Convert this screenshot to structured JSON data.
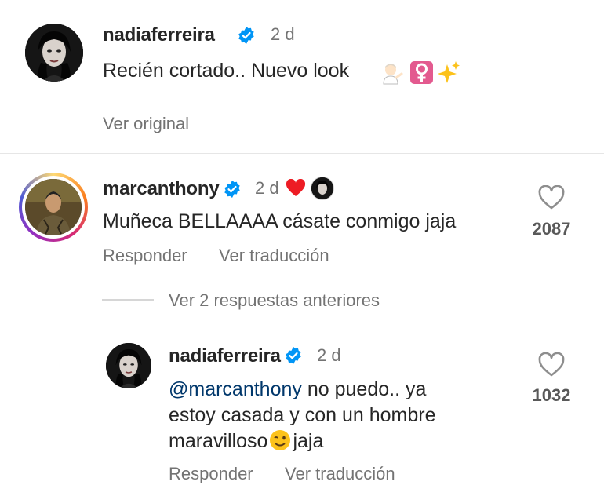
{
  "caption": {
    "username": "nadiaferreira",
    "time": "2 d",
    "text": "Recién cortado.. Nuevo look",
    "see_original": "Ver original"
  },
  "comments": [
    {
      "username": "marcanthony",
      "time": "2 d",
      "text": "Muñeca BELLAAAA cásate conmigo jaja",
      "likes": "2087",
      "reply_label": "Responder",
      "translate_label": "Ver traducción",
      "has_story_ring": true
    }
  ],
  "view_replies": "Ver 2 respuestas anteriores",
  "reply": {
    "username": "nadiaferreira",
    "time": "2 d",
    "mention": "@marcanthony",
    "line1": " no puedo.. ya",
    "line2": "estoy casada y con un hombre",
    "line3": "maravilloso",
    "line3_after": "jaja",
    "likes": "1032",
    "reply_label": "Responder",
    "translate_label": "Ver traducción"
  },
  "colors": {
    "verified_blue": "#0095f6",
    "heart_red": "#ed4956",
    "text_dark": "#262626",
    "text_gray": "#737373",
    "mention_blue": "#00376b"
  },
  "icons": [
    "verified-badge-icon",
    "heart-outline-icon",
    "red-heart-icon",
    "person-gesturing-emoji",
    "female-sign-emoji",
    "sparkles-emoji",
    "winking-face-emoji"
  ]
}
